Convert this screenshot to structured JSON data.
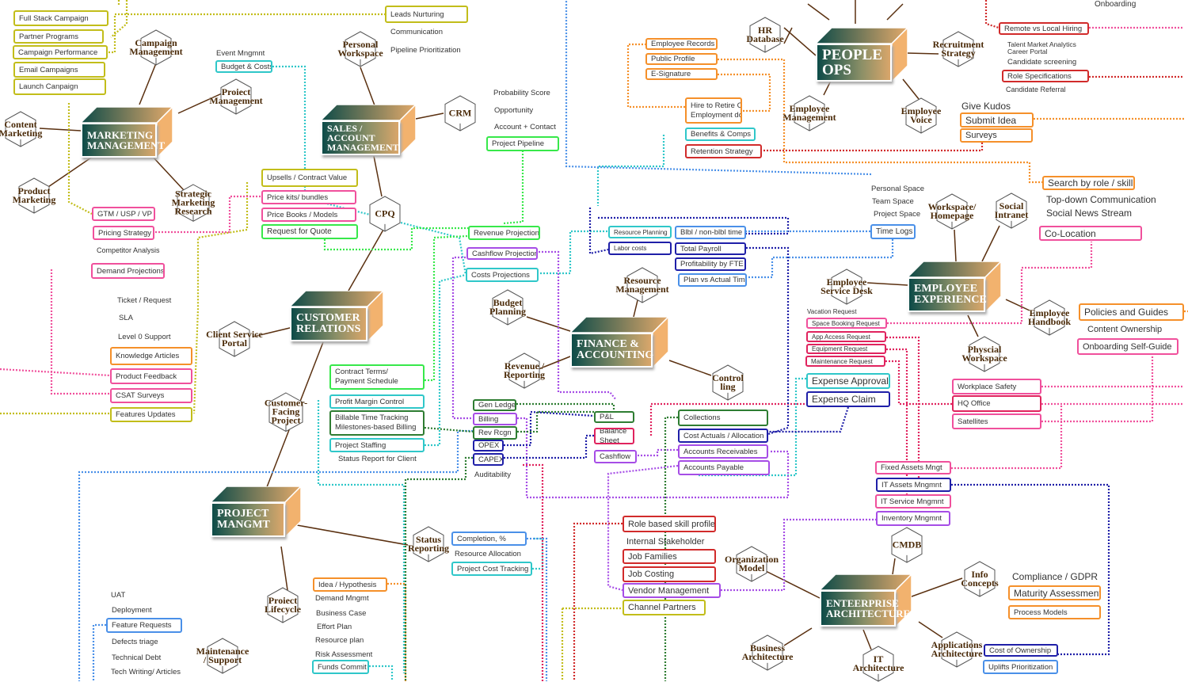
{
  "diagram_title": "Business Capability Mind Map",
  "colors": {
    "olive": "#c2bd1a",
    "pink": "#f0509c",
    "cyan": "#2fc7c9",
    "green": "#37e84a",
    "darkgreen": "#2e7d32",
    "purple": "#a64de6",
    "navy": "#1f1fa8",
    "blue": "#4a90e8",
    "orange": "#f5902a",
    "red": "#d12b2b",
    "crimson": "#e0235e",
    "branch": "#5a3010"
  },
  "hubs": [
    {
      "id": "marketing",
      "label": "MARKETING\nMANAGEMENT"
    },
    {
      "id": "sales",
      "label": "SALES /\nACCOUNT\nMANAGEMENT"
    },
    {
      "id": "people",
      "label": "PEOPLE\nOPS"
    },
    {
      "id": "customer",
      "label": "CUSTOMER\nRELATIONS"
    },
    {
      "id": "finance",
      "label": "FINANCE &\nACCOUNTING"
    },
    {
      "id": "employee",
      "label": "EMPLOYEE\nEXPERIENCE"
    },
    {
      "id": "project",
      "label": "PROJECT\nMANGMT"
    },
    {
      "id": "enterprise",
      "label": "ENTEERPRISE\nARCHITECTURE"
    }
  ],
  "hexes": [
    {
      "label": "Campaign\nManagement"
    },
    {
      "label": "Proiect\nManagement"
    },
    {
      "label": "Content\nMarketing"
    },
    {
      "label": "Product\nMarketing"
    },
    {
      "label": "Strategic\nMarketing\nResearch"
    },
    {
      "label": "Personal\nWorkspace"
    },
    {
      "label": "CRM"
    },
    {
      "label": "CPQ"
    },
    {
      "label": "HR\nDatabase"
    },
    {
      "label": "Recruitment\nStrategy"
    },
    {
      "label": "Employee\nManagement"
    },
    {
      "label": "Employee\nVoice"
    },
    {
      "label": "Client Service\nPortal"
    },
    {
      "label": "Customer-\nFacing\nProject"
    },
    {
      "label": "Budget\nPlanning"
    },
    {
      "label": "Resource\nManagement"
    },
    {
      "label": "Revenue /\nReporting"
    },
    {
      "label": "Control\nling"
    },
    {
      "label": "Workspace/\nHomepage"
    },
    {
      "label": "Social\nIntranet"
    },
    {
      "label": "Employee\nService Desk"
    },
    {
      "label": "Employee\nHandbook"
    },
    {
      "label": "Physcial\nWorkspace"
    },
    {
      "label": "Status\nReporting"
    },
    {
      "label": "Proiect\nLifecycle"
    },
    {
      "label": "Maintenance\n/ Support"
    },
    {
      "label": "Organization\nModel"
    },
    {
      "label": "CMDB"
    },
    {
      "label": "Info\nConcepts"
    },
    {
      "label": "Business\nArchitecture"
    },
    {
      "label": "IT\nArchitecture"
    },
    {
      "label": "Applications\nArchitecture"
    }
  ],
  "boxes": [
    {
      "label": "Full Stack Campaign",
      "color": "olive"
    },
    {
      "label": "Partner Programs",
      "color": "olive"
    },
    {
      "label": "Campaign Performance",
      "color": "olive"
    },
    {
      "label": "Email Campaigns",
      "color": "olive"
    },
    {
      "label": "Launch Canpaign",
      "color": "olive"
    },
    {
      "label": "Leads Nurturing",
      "color": "olive"
    },
    {
      "label": "Budget & Costs",
      "color": "cyan"
    },
    {
      "label": "Project Pipeline",
      "color": "green"
    },
    {
      "label": "Upsells / Contract Value",
      "color": "olive"
    },
    {
      "label": "Price kits/  bundles",
      "color": "pink"
    },
    {
      "label": "Price Books / Models",
      "color": "pink"
    },
    {
      "label": "Request for Quote",
      "color": "green"
    },
    {
      "label": "GTM / USP / VP",
      "color": "pink"
    },
    {
      "label": "Pricing Strategy",
      "color": "pink"
    },
    {
      "label": "Demand Projections",
      "color": "pink"
    },
    {
      "label": "Employee Records",
      "color": "orange"
    },
    {
      "label": "Public Profile",
      "color": "orange"
    },
    {
      "label": "E-Signature",
      "color": "orange"
    },
    {
      "label": "Hire to Retire Cycle\nEmployment docs",
      "color": "orange"
    },
    {
      "label": "Benefits & Comps",
      "color": "cyan"
    },
    {
      "label": "Retention Strategy",
      "color": "red"
    },
    {
      "label": "Remote vs Local Hiring",
      "color": "red"
    },
    {
      "label": "Role Specifications",
      "color": "red"
    },
    {
      "label": "Submit Idea",
      "color": "orange"
    },
    {
      "label": "Surveys",
      "color": "orange"
    },
    {
      "label": "Search by role / skill",
      "color": "orange"
    },
    {
      "label": "Co-Location",
      "color": "pink"
    },
    {
      "label": "Revenue Projection",
      "color": "green"
    },
    {
      "label": "Cashflow Projection",
      "color": "purple"
    },
    {
      "label": "Costs Projections",
      "color": "cyan"
    },
    {
      "label": "Resource Planning",
      "color": "cyan"
    },
    {
      "label": "Blbl / non-blbl time",
      "color": "blue"
    },
    {
      "label": "Labor costs",
      "color": "navy"
    },
    {
      "label": "Total Payroll",
      "color": "navy"
    },
    {
      "label": "Profitability by FTE",
      "color": "navy"
    },
    {
      "label": "Plan vs Actual Time",
      "color": "blue"
    },
    {
      "label": "Time Logs",
      "color": "blue"
    },
    {
      "label": "Knowledge Articles",
      "color": "orange"
    },
    {
      "label": "Product Feedback",
      "color": "pink"
    },
    {
      "label": "CSAT Surveys",
      "color": "pink"
    },
    {
      "label": "Features Updates",
      "color": "olive"
    },
    {
      "label": "Contract Terms/\nPayment Schedule",
      "color": "green"
    },
    {
      "label": "Profit Margin Control",
      "color": "cyan"
    },
    {
      "label": "Billable Time Tracking\nMilestones-based Billing",
      "color": "darkgreen"
    },
    {
      "label": "Project Staffing",
      "color": "cyan"
    },
    {
      "label": "Gen Ledger",
      "color": "darkgreen"
    },
    {
      "label": "Billing",
      "color": "purple"
    },
    {
      "label": "Rev Rcgn",
      "color": "darkgreen"
    },
    {
      "label": "OPEX",
      "color": "navy"
    },
    {
      "label": "CAPEX",
      "color": "navy"
    },
    {
      "label": "P&L",
      "color": "darkgreen"
    },
    {
      "label": "Balance\nSheet",
      "color": "crimson"
    },
    {
      "label": "Cashflow",
      "color": "purple"
    },
    {
      "label": "Collections",
      "color": "darkgreen"
    },
    {
      "label": "Cost Actuals / Allocation",
      "color": "navy"
    },
    {
      "label": "Accounts Receivables",
      "color": "purple"
    },
    {
      "label": "Accounts Payable",
      "color": "purple"
    },
    {
      "label": "Expense Approvals",
      "color": "cyan"
    },
    {
      "label": "Expense Claim",
      "color": "navy"
    },
    {
      "label": "Space Booking Request",
      "color": "pink"
    },
    {
      "label": "App Access Request",
      "color": "crimson"
    },
    {
      "label": "Equipment Request",
      "color": "crimson"
    },
    {
      "label": "Maintenance Request",
      "color": "crimson"
    },
    {
      "label": "Policies and Guides",
      "color": "orange"
    },
    {
      "label": "Onboarding Self-Guide",
      "color": "pink"
    },
    {
      "label": "Workplace Safety",
      "color": "pink"
    },
    {
      "label": "HQ Office",
      "color": "crimson"
    },
    {
      "label": "Satellites",
      "color": "pink"
    },
    {
      "label": "Fixed Assets Mngt",
      "color": "pink"
    },
    {
      "label": "IT Assets Mngmnt",
      "color": "navy"
    },
    {
      "label": "IT Service Mngmnt",
      "color": "pink"
    },
    {
      "label": "Inventory Mngmnt",
      "color": "purple"
    },
    {
      "label": "Maturity Assessment",
      "color": "orange"
    },
    {
      "label": "Process Models",
      "color": "orange"
    },
    {
      "label": "Cost of Ownership",
      "color": "navy"
    },
    {
      "label": "Uplifts Prioritization",
      "color": "blue"
    },
    {
      "label": "Role based skill profile",
      "color": "red"
    },
    {
      "label": "Job Families",
      "color": "red"
    },
    {
      "label": "Job Costing",
      "color": "red"
    },
    {
      "label": "Vendor Management",
      "color": "purple"
    },
    {
      "label": "Channel Partners",
      "color": "olive"
    },
    {
      "label": "Completion, %",
      "color": "blue"
    },
    {
      "label": "Project Cost Tracking",
      "color": "cyan"
    },
    {
      "label": "Idea / Hypothesis",
      "color": "orange"
    },
    {
      "label": "Funds Commit",
      "color": "cyan"
    },
    {
      "label": "Feature Requests",
      "color": "blue"
    }
  ],
  "texts": [
    "Event Mngmnt",
    "Communication",
    "Pipeline Prioritization",
    "Probability Score",
    "Opportunity",
    "Account + Contact",
    "Competitor Analysis",
    "Onboarding",
    "Talent Market Analytics",
    "Career Portal",
    "Candidate screening",
    "Candidate Referral",
    "Give Kudos",
    "Top-down Communication",
    "Social News Stream",
    "Personal Space",
    "Team Space",
    "Project Space",
    "Ticket / Request",
    "SLA",
    "Level 0 Support",
    "Status Report for Client",
    "Auditability",
    "Vacation Request",
    "Content Ownership",
    "Compliance / GDPR",
    "Internal Stakeholder",
    "Resource Allocation",
    "Demand Mngmt",
    "Business Case",
    "Effort Plan",
    "Resource plan",
    "Risk Assessment",
    "UAT",
    "Deployment",
    "Defects triage",
    "Technical Debt",
    "Tech Writing/ Articles"
  ]
}
